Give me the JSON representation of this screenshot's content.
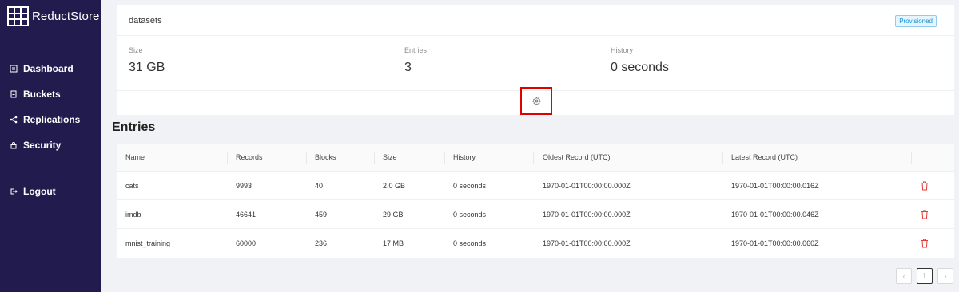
{
  "app": {
    "name": "ReductStore"
  },
  "sidebar": {
    "items": [
      {
        "label": "Dashboard",
        "icon": "dashboard-icon"
      },
      {
        "label": "Buckets",
        "icon": "buckets-icon"
      },
      {
        "label": "Replications",
        "icon": "share-icon"
      },
      {
        "label": "Security",
        "icon": "lock-icon"
      }
    ],
    "logout": {
      "label": "Logout",
      "icon": "logout-icon"
    }
  },
  "bucket": {
    "name": "datasets",
    "badge": "Provisioned",
    "stats": [
      {
        "label": "Size",
        "value": "31 GB"
      },
      {
        "label": "Entries",
        "value": "3"
      },
      {
        "label": "History",
        "value": "0 seconds"
      }
    ]
  },
  "entries": {
    "title": "Entries",
    "columns": [
      "Name",
      "Records",
      "Blocks",
      "Size",
      "History",
      "Oldest Record (UTC)",
      "Latest Record (UTC)"
    ],
    "rows": [
      [
        "cats",
        "9993",
        "40",
        "2.0 GB",
        "0 seconds",
        "1970-01-01T00:00:00.000Z",
        "1970-01-01T00:00:00.016Z"
      ],
      [
        "imdb",
        "46641",
        "459",
        "29 GB",
        "0 seconds",
        "1970-01-01T00:00:00.000Z",
        "1970-01-01T00:00:00.046Z"
      ],
      [
        "mnist_training",
        "60000",
        "236",
        "17 MB",
        "0 seconds",
        "1970-01-01T00:00:00.000Z",
        "1970-01-01T00:00:00.060Z"
      ]
    ]
  },
  "pagination": {
    "current": "1",
    "prev": "‹",
    "next": "›"
  },
  "colors": {
    "sidebar": "#221b4d",
    "delete": "#e53935",
    "highlight": "#e00000"
  }
}
